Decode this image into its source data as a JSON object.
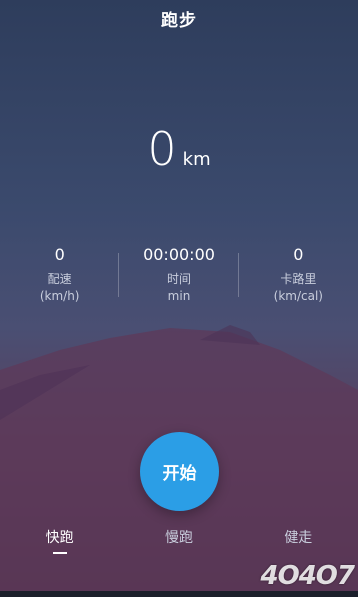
{
  "header": {
    "title": "跑步"
  },
  "distance": {
    "value": "0",
    "unit": "km"
  },
  "stats": [
    {
      "value": "0",
      "label": "配速",
      "unit": "(km/h)"
    },
    {
      "value": "00:00:00",
      "label": "时间",
      "unit": "min"
    },
    {
      "value": "0",
      "label": "卡路里",
      "unit": "(km/cal)"
    }
  ],
  "start_button": {
    "label": "开始",
    "color": "#2b9ee6"
  },
  "tabs": [
    {
      "label": "快跑",
      "active": true
    },
    {
      "label": "慢跑",
      "active": false
    },
    {
      "label": "健走",
      "active": false
    }
  ],
  "watermark": {
    "text": "4O4O7"
  }
}
